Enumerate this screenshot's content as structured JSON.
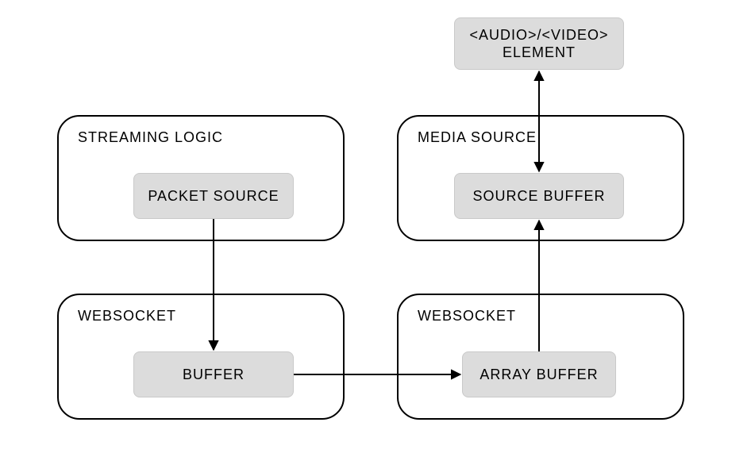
{
  "containers": {
    "streaming_logic": {
      "label": "STREAMING LOGIC"
    },
    "websocket_left": {
      "label": "WEBSOCKET"
    },
    "media_source": {
      "label": "MEDIA SOURCE"
    },
    "websocket_right": {
      "label": "WEBSOCKET"
    }
  },
  "nodes": {
    "audio_video_element": {
      "label": "<AUDIO>/<VIDEO>\nELEMENT"
    },
    "packet_source": {
      "label": "PACKET SOURCE"
    },
    "source_buffer": {
      "label": "SOURCE BUFFER"
    },
    "buffer": {
      "label": "BUFFER"
    },
    "array_buffer": {
      "label": "ARRAY BUFFER"
    }
  }
}
